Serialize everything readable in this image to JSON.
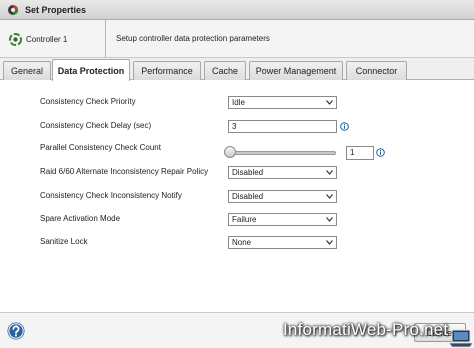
{
  "window": {
    "title": "Set Properties"
  },
  "header": {
    "controller_label": "Controller 1",
    "description": "Setup controller data protection parameters"
  },
  "tabs": [
    {
      "label": "General"
    },
    {
      "label": "Data Protection"
    },
    {
      "label": "Performance"
    },
    {
      "label": "Cache"
    },
    {
      "label": "Power Management"
    },
    {
      "label": "Connector"
    }
  ],
  "active_tab": "Data Protection",
  "fields": {
    "cc_priority": {
      "label": "Consistency Check Priority",
      "value": "Idle"
    },
    "cc_delay": {
      "label": "Consistency Check Delay (sec)",
      "value": "3"
    },
    "parallel_cc": {
      "label": "Parallel Consistency Check Count",
      "value": "1",
      "slider_fraction": 0
    },
    "raid_policy": {
      "label": "Raid 6/60 Alternate Inconsistency Repair Policy",
      "value": "Disabled"
    },
    "cc_notify": {
      "label": "Consistency Check Inconsistency Notify",
      "value": "Disabled"
    },
    "spare_mode": {
      "label": "Spare Activation Mode",
      "value": "Failure"
    },
    "sanitize": {
      "label": "Sanitize Lock",
      "value": "None"
    }
  },
  "footer": {
    "cancel_label": "Cancel"
  },
  "watermark": {
    "text": "InformatiWeb-Pro.net"
  },
  "colors": {
    "accent": "#1f5fa8",
    "help": "#2d5f9c"
  }
}
